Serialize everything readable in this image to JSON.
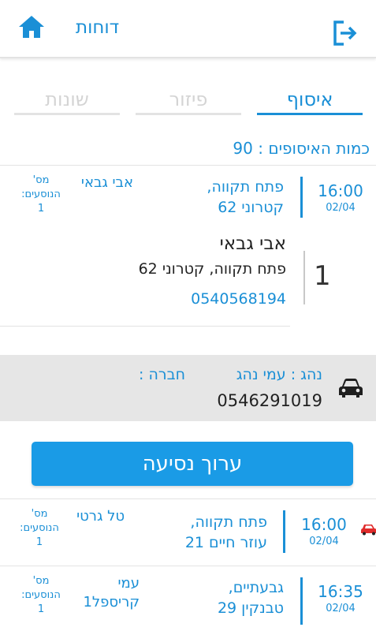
{
  "header": {
    "reports_label": "דוחות",
    "home_icon": "home-icon",
    "logout_icon": "logout-icon"
  },
  "tabs": [
    {
      "label": "איסוף",
      "active": true
    },
    {
      "label": "פיזור",
      "active": false
    },
    {
      "label": "שונות",
      "active": false
    }
  ],
  "pickup_count_text": "כמות האיסופים : 90",
  "trips": [
    {
      "time": "16:00",
      "date": "02/04",
      "address_line1": "פתח תקווה,",
      "address_line2": "קטרוני 62",
      "passenger_line1": "אבי גבאי",
      "passenger_line2": "",
      "passengers_label": "מס' הנוסעים:",
      "passengers_count": "1",
      "has_car_icon": false
    },
    {
      "time": "16:00",
      "date": "02/04",
      "address_line1": "פתח תקווה,",
      "address_line2": "עוזר חיים 21",
      "passenger_line1": "טל גרטי",
      "passenger_line2": "",
      "passengers_label": "מס' הנוסעים:",
      "passengers_count": "1",
      "has_car_icon": true
    },
    {
      "time": "16:35",
      "date": "02/04",
      "address_line1": "גבעתיים,",
      "address_line2": "טבנקין 29",
      "passenger_line1": "עמי",
      "passenger_line2": "קריספל1",
      "passengers_label": "מס' הנוסעים:",
      "passengers_count": "1",
      "has_car_icon": false
    }
  ],
  "detail": {
    "index": "1",
    "name": "אבי גבאי",
    "address": "פתח תקווה, קטרוני 62",
    "phone": "0540568194"
  },
  "driver": {
    "driver_label": "נהג : עמי נהג",
    "company_label": "חברה :",
    "phone": "0546291019",
    "car_icon": "car-icon"
  },
  "edit_trip_label": "ערוך נסיעה",
  "colors": {
    "accent": "#1a8fd6",
    "button": "#1a9be6",
    "panel": "#e6e6e6",
    "car_red": "#e02b2b"
  }
}
